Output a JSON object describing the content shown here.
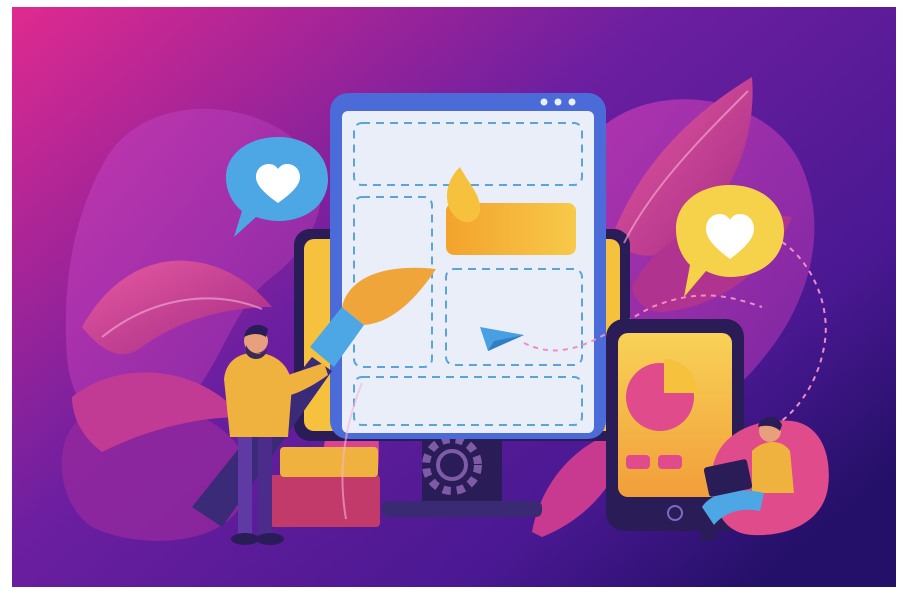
{
  "image": {
    "alt": "",
    "colors": {
      "bg_left": "#e02a8f",
      "bg_mid": "#6c1fa0",
      "bg_right": "#4a1892",
      "bg_bottom": "#241068",
      "blob_pink": "#c23ab3",
      "blob_violet": "#8a2aa6",
      "leaf_pink": "#d83f8d",
      "leaf_dark": "#a12a86",
      "device_dark": "#2a1c57",
      "screen_light": "#e9eef9",
      "screen_border": "#b6c7ee",
      "dash_line": "#5aa5d6",
      "yellow": "#f6c23d",
      "orange": "#f1a72c",
      "heart_bubble_blue": "#4ea7e5",
      "heart_bubble_yellow": "#f6d24a",
      "white": "#ffffff",
      "paper_plane": "#48a0e3",
      "gear": "#7e5aa7",
      "phone_pie_pink": "#e04b8c",
      "phone_pie_yellow": "#f6c23d",
      "person_shirt": "#f0b23f",
      "person_pants": "#5f3aa4",
      "person_skin": "#e8a07c"
    },
    "icons": [
      "heart-bubble-icon",
      "heart-bubble-icon",
      "paper-plane-icon",
      "gear-icon",
      "pie-chart-icon",
      "paint-brush-icon"
    ]
  }
}
